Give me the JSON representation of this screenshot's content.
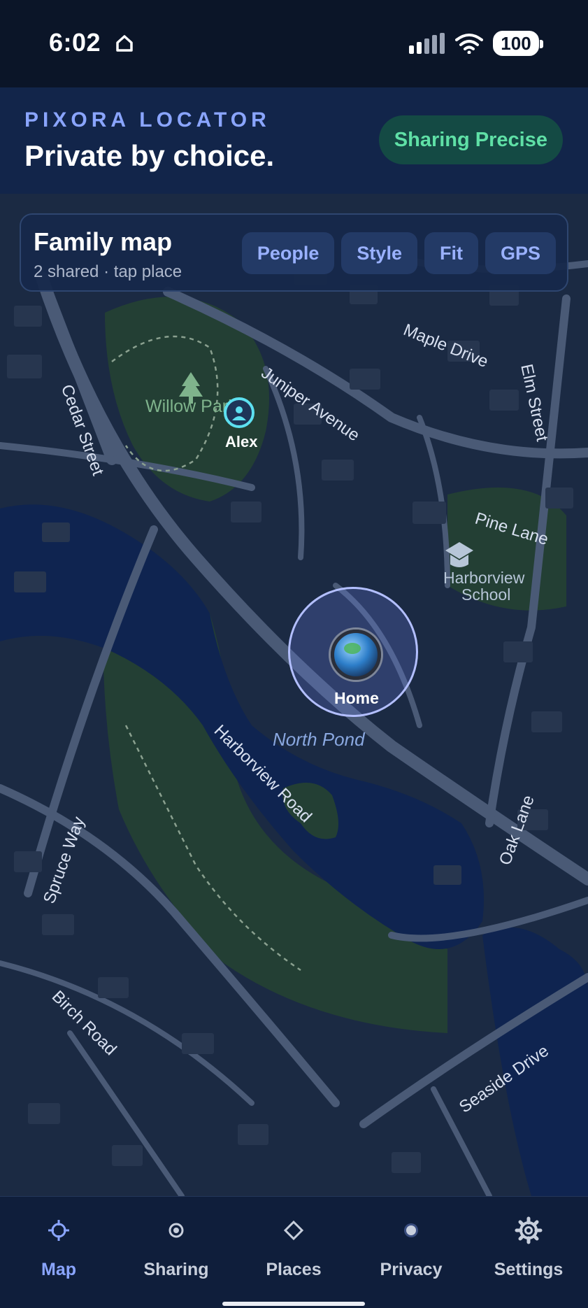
{
  "status_bar": {
    "time": "6:02",
    "battery": "100"
  },
  "header": {
    "brand": "PIXORA LOCATOR",
    "tagline": "Private by choice.",
    "share_status": "Sharing Precise"
  },
  "map_card": {
    "title": "Family map",
    "subtitle": "2 shared · tap place",
    "actions": [
      "People",
      "Style",
      "Fit",
      "GPS"
    ]
  },
  "map": {
    "streets": {
      "cedar": "Cedar Street",
      "juniper": "Juniper Avenue",
      "maple": "Maple Drive",
      "elm": "Elm Street",
      "pine": "Pine Lane",
      "harborview": "Harborview Road",
      "oak": "Oak Lane",
      "spruce": "Spruce Way",
      "birch": "Birch Road",
      "seaside": "Seaside Drive"
    },
    "places": {
      "park": "Willow Park",
      "school_line1": "Harborview",
      "school_line2": "School",
      "pond": "North Pond"
    },
    "markers": {
      "alex": "Alex",
      "home": "Home"
    }
  },
  "tabs": [
    {
      "label": "Map",
      "icon": "crosshair-icon",
      "active": true
    },
    {
      "label": "Sharing",
      "icon": "target-dot-icon",
      "active": false
    },
    {
      "label": "Places",
      "icon": "diamond-icon",
      "active": false
    },
    {
      "label": "Privacy",
      "icon": "dot-circle-icon",
      "active": false
    },
    {
      "label": "Settings",
      "icon": "gear-icon",
      "active": false
    }
  ],
  "colors": {
    "accent": "#8aa5ff",
    "share_green": "#5fe0a6",
    "water": "#0f2450",
    "park": "#233f34"
  }
}
